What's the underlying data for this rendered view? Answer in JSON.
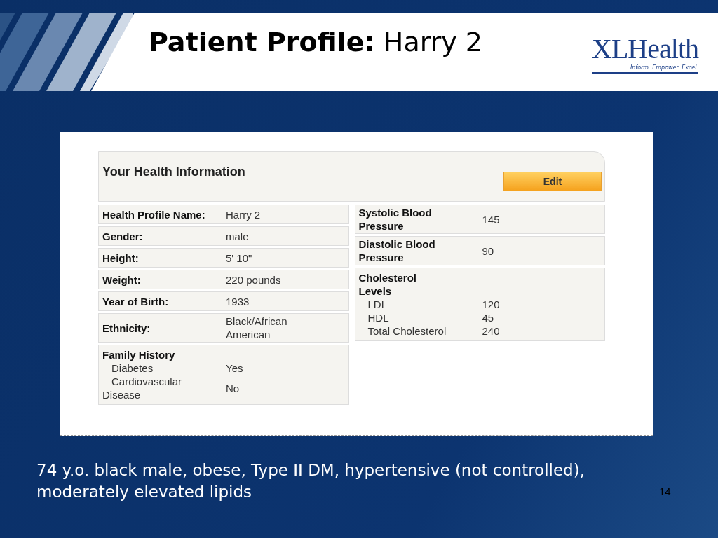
{
  "slide": {
    "title": "**Patient Profile:** Harry 2",
    "logo": {
      "name": "XLHealth",
      "tagline": "Inform. Empower. Excel."
    },
    "page_number": "14",
    "caption": "74 y.o. black male, obese, Type II DM, hypertensive (not controlled), moderately elevated lipids"
  },
  "panel": {
    "title": "Your Health Information",
    "edit_button": "Edit",
    "left_rows": [
      {
        "kind": "field",
        "label": "Health Profile Name:",
        "value": "Harry 2"
      },
      {
        "kind": "field",
        "label": "Gender:",
        "value": "male"
      },
      {
        "kind": "field",
        "label": "Height:",
        "value": "5' 10\""
      },
      {
        "kind": "field",
        "label": "Weight:",
        "value": "220 pounds"
      },
      {
        "kind": "field",
        "label": "Year of Birth:",
        "value": "1933"
      },
      {
        "kind": "field",
        "label": "Ethnicity:",
        "value": "Black/African American"
      },
      {
        "kind": "group",
        "label": "Family History",
        "items": [
          {
            "label": "Diabetes",
            "value": "Yes"
          },
          {
            "label": "Cardiovascular Disease",
            "value": "No"
          }
        ]
      }
    ],
    "right_rows": [
      {
        "kind": "field",
        "label": "Systolic Blood Pressure",
        "value": "145"
      },
      {
        "kind": "field",
        "label": "Diastolic Blood Pressure",
        "value": "90"
      },
      {
        "kind": "group",
        "label": "Cholesterol Levels",
        "items": [
          {
            "label": "LDL",
            "value": "120"
          },
          {
            "label": "HDL",
            "value": "45"
          },
          {
            "label": "Total Cholesterol",
            "value": "240"
          }
        ]
      }
    ]
  }
}
